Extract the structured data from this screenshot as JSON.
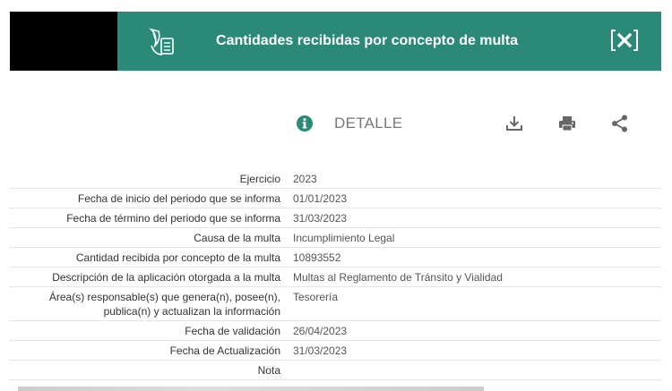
{
  "header": {
    "title": "Cantidades recibidas por concepto de multa",
    "icon": "document-feather-icon",
    "close_icon": "close-x-icon",
    "accent_color": "#2b8a77"
  },
  "toolbar": {
    "info_icon": "info-icon",
    "label": "DETALLE",
    "download_icon": "download-icon",
    "print_icon": "print-icon",
    "share_icon": "share-icon"
  },
  "rows": [
    {
      "label": "Ejercicio",
      "value": "2023"
    },
    {
      "label": "Fecha de inicio del periodo que se informa",
      "value": "01/01/2023"
    },
    {
      "label": "Fecha de término del periodo que se informa",
      "value": "31/03/2023"
    },
    {
      "label": "Causa de la multa",
      "value": "Incumplimiento Legal"
    },
    {
      "label": "Cantidad recibida por concepto de la multa",
      "value": "10893552"
    },
    {
      "label": "Descripción de la aplicación otorgada a la multa",
      "value": "Multas al Reglamento de Tránsito y Vialidad"
    },
    {
      "label": "Área(s) responsable(s) que genera(n), posee(n), publica(n) y actualizan la información",
      "value": "Tesorería"
    },
    {
      "label": "Fecha de validación",
      "value": "26/04/2023"
    },
    {
      "label": "Fecha de Actualización",
      "value": "31/03/2023"
    },
    {
      "label": "Nota",
      "value": ""
    }
  ]
}
